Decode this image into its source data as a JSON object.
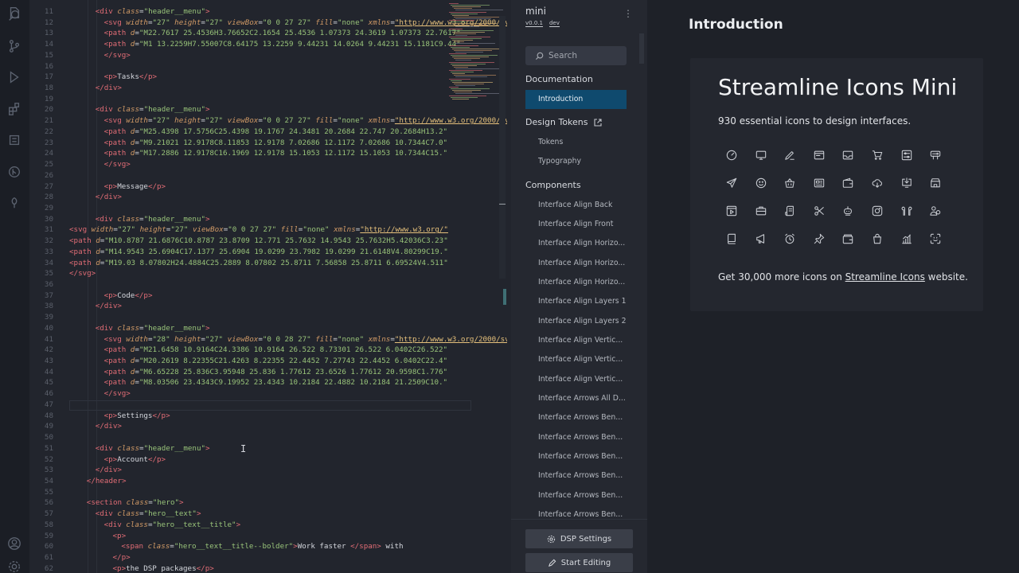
{
  "activity_bar": {
    "icons": [
      "files-icon",
      "search-icon",
      "source-control-icon",
      "run-debug-icon",
      "extensions-icon",
      "list-icon",
      "git-graph-icon",
      "plugin-icon"
    ],
    "bottom_icons": [
      "account-icon",
      "gear-icon"
    ]
  },
  "editor": {
    "lines": [
      {
        "n": "11",
        "indent": 6,
        "parts": [
          [
            "tag",
            "<div "
          ],
          [
            "attr",
            "class"
          ],
          [
            "txt",
            "="
          ],
          [
            "str",
            "\"header__menu\""
          ],
          [
            "tag",
            ">"
          ]
        ]
      },
      {
        "n": "12",
        "indent": 8,
        "parts": [
          [
            "tag",
            "<svg "
          ],
          [
            "attr",
            "width"
          ],
          [
            "txt",
            "="
          ],
          [
            "str",
            "\"27\" "
          ],
          [
            "attr",
            "height"
          ],
          [
            "txt",
            "="
          ],
          [
            "str",
            "\"27\" "
          ],
          [
            "attr",
            "viewBox"
          ],
          [
            "txt",
            "="
          ],
          [
            "str",
            "\"0 0 27 27\" "
          ],
          [
            "attr",
            "fill"
          ],
          [
            "txt",
            "="
          ],
          [
            "str",
            "\"none\" "
          ],
          [
            "attr",
            "xmlns"
          ],
          [
            "txt",
            "="
          ],
          [
            "url",
            "\"http://www.w3.org/2000/svg\""
          ]
        ]
      },
      {
        "n": "13",
        "indent": 8,
        "parts": [
          [
            "tag",
            "<path "
          ],
          [
            "attr",
            "d"
          ],
          [
            "txt",
            "="
          ],
          [
            "str",
            "\"M22.7617 25.4536H3.76652C2.1654 25.4536 1.07373 24.3619 1.07373 22.7617\""
          ]
        ]
      },
      {
        "n": "14",
        "indent": 8,
        "parts": [
          [
            "tag",
            "<path "
          ],
          [
            "attr",
            "d"
          ],
          [
            "txt",
            "="
          ],
          [
            "str",
            "\"M1 13.2259H7.55007C8.64175 13.2259 9.44231 14.0264 9.44231 15.1181C9.44\""
          ]
        ]
      },
      {
        "n": "15",
        "indent": 8,
        "parts": [
          [
            "tag",
            "</svg>"
          ]
        ]
      },
      {
        "n": "16",
        "indent": 0,
        "parts": []
      },
      {
        "n": "17",
        "indent": 8,
        "parts": [
          [
            "tag",
            "<p>"
          ],
          [
            "txt",
            "Tasks"
          ],
          [
            "tag",
            "</p>"
          ]
        ]
      },
      {
        "n": "18",
        "indent": 6,
        "parts": [
          [
            "tag",
            "</div>"
          ]
        ]
      },
      {
        "n": "19",
        "indent": 0,
        "parts": []
      },
      {
        "n": "20",
        "indent": 6,
        "parts": [
          [
            "tag",
            "<div "
          ],
          [
            "attr",
            "class"
          ],
          [
            "txt",
            "="
          ],
          [
            "str",
            "\"header__menu\""
          ],
          [
            "tag",
            ">"
          ]
        ]
      },
      {
        "n": "21",
        "indent": 8,
        "parts": [
          [
            "tag",
            "<svg "
          ],
          [
            "attr",
            "width"
          ],
          [
            "txt",
            "="
          ],
          [
            "str",
            "\"27\" "
          ],
          [
            "attr",
            "height"
          ],
          [
            "txt",
            "="
          ],
          [
            "str",
            "\"27\" "
          ],
          [
            "attr",
            "viewBox"
          ],
          [
            "txt",
            "="
          ],
          [
            "str",
            "\"0 0 27 27\" "
          ],
          [
            "attr",
            "fill"
          ],
          [
            "txt",
            "="
          ],
          [
            "str",
            "\"none\" "
          ],
          [
            "attr",
            "xmlns"
          ],
          [
            "txt",
            "="
          ],
          [
            "url",
            "\"http://www.w3.org/2000/svg\""
          ]
        ]
      },
      {
        "n": "22",
        "indent": 8,
        "parts": [
          [
            "tag",
            "<path "
          ],
          [
            "attr",
            "d"
          ],
          [
            "txt",
            "="
          ],
          [
            "str",
            "\"M25.4398 17.5756C25.4398 19.1767 24.3481 20.2684 22.747 20.2684H13.2\""
          ]
        ]
      },
      {
        "n": "23",
        "indent": 8,
        "parts": [
          [
            "tag",
            "<path "
          ],
          [
            "attr",
            "d"
          ],
          [
            "txt",
            "="
          ],
          [
            "str",
            "\"M9.21021 12.9178C8.11853 12.9178 7.02686 12.1172 7.02686 10.7344C7.0\""
          ]
        ]
      },
      {
        "n": "24",
        "indent": 8,
        "parts": [
          [
            "tag",
            "<path "
          ],
          [
            "attr",
            "d"
          ],
          [
            "txt",
            "="
          ],
          [
            "str",
            "\"M17.2886 12.9178C16.1969 12.9178 15.1053 12.1172 15.1053 10.7344C15.\""
          ]
        ]
      },
      {
        "n": "25",
        "indent": 8,
        "parts": [
          [
            "tag",
            "</svg>"
          ]
        ]
      },
      {
        "n": "26",
        "indent": 0,
        "parts": []
      },
      {
        "n": "27",
        "indent": 8,
        "parts": [
          [
            "tag",
            "<p>"
          ],
          [
            "txt",
            "Message"
          ],
          [
            "tag",
            "</p>"
          ]
        ]
      },
      {
        "n": "28",
        "indent": 6,
        "parts": [
          [
            "tag",
            "</div>"
          ]
        ]
      },
      {
        "n": "29",
        "indent": 0,
        "parts": []
      },
      {
        "n": "30",
        "indent": 6,
        "parts": [
          [
            "tag",
            "<div "
          ],
          [
            "attr",
            "class"
          ],
          [
            "txt",
            "="
          ],
          [
            "str",
            "\"header__menu\""
          ],
          [
            "tag",
            ">"
          ]
        ]
      },
      {
        "n": "31",
        "indent": 0,
        "parts": [
          [
            "tag",
            "<svg "
          ],
          [
            "attr",
            "width"
          ],
          [
            "txt",
            "="
          ],
          [
            "str",
            "\"27\" "
          ],
          [
            "attr",
            "height"
          ],
          [
            "txt",
            "="
          ],
          [
            "str",
            "\"27\" "
          ],
          [
            "attr",
            "viewBox"
          ],
          [
            "txt",
            "="
          ],
          [
            "str",
            "\"0 0 27 27\" "
          ],
          [
            "attr",
            "fill"
          ],
          [
            "txt",
            "="
          ],
          [
            "str",
            "\"none\" "
          ],
          [
            "attr",
            "xmlns"
          ],
          [
            "txt",
            "="
          ],
          [
            "url",
            "\"http://www.w3.org/\""
          ]
        ]
      },
      {
        "n": "32",
        "indent": 0,
        "parts": [
          [
            "tag",
            "<path "
          ],
          [
            "attr",
            "d"
          ],
          [
            "txt",
            "="
          ],
          [
            "str",
            "\"M10.8787 21.6876C10.8787 23.8709 12.771 25.7632 14.9543 25.7632H5.42036C3.23\""
          ]
        ]
      },
      {
        "n": "33",
        "indent": 0,
        "parts": [
          [
            "tag",
            "<path "
          ],
          [
            "attr",
            "d"
          ],
          [
            "txt",
            "="
          ],
          [
            "str",
            "\"M14.9543 25.6904C17.1377 25.6904 19.0299 23.7982 19.0299 21.6148V4.80299C19.\""
          ]
        ]
      },
      {
        "n": "34",
        "indent": 0,
        "parts": [
          [
            "tag",
            "<path "
          ],
          [
            "attr",
            "d"
          ],
          [
            "txt",
            "="
          ],
          [
            "str",
            "\"M19.03 8.07802H24.4884C25.2889 8.07802 25.8711 7.56858 25.8711 6.69524V4.511\""
          ]
        ]
      },
      {
        "n": "35",
        "indent": 0,
        "parts": [
          [
            "tag",
            "</svg>"
          ]
        ]
      },
      {
        "n": "36",
        "indent": 0,
        "parts": []
      },
      {
        "n": "37",
        "indent": 8,
        "parts": [
          [
            "tag",
            "<p>"
          ],
          [
            "txt",
            "Code"
          ],
          [
            "tag",
            "</p>"
          ]
        ]
      },
      {
        "n": "38",
        "indent": 6,
        "parts": [
          [
            "tag",
            "</div>"
          ]
        ]
      },
      {
        "n": "39",
        "indent": 0,
        "parts": []
      },
      {
        "n": "40",
        "indent": 6,
        "parts": [
          [
            "tag",
            "<div "
          ],
          [
            "attr",
            "class"
          ],
          [
            "txt",
            "="
          ],
          [
            "str",
            "\"header__menu\""
          ],
          [
            "tag",
            ">"
          ]
        ]
      },
      {
        "n": "41",
        "indent": 8,
        "parts": [
          [
            "tag",
            "<svg "
          ],
          [
            "attr",
            "width"
          ],
          [
            "txt",
            "="
          ],
          [
            "str",
            "\"28\" "
          ],
          [
            "attr",
            "height"
          ],
          [
            "txt",
            "="
          ],
          [
            "str",
            "\"27\" "
          ],
          [
            "attr",
            "viewBox"
          ],
          [
            "txt",
            "="
          ],
          [
            "str",
            "\"0 0 28 27\" "
          ],
          [
            "attr",
            "fill"
          ],
          [
            "txt",
            "="
          ],
          [
            "str",
            "\"none\" "
          ],
          [
            "attr",
            "xmlns"
          ],
          [
            "txt",
            "="
          ],
          [
            "url",
            "\"http://www.w3.org/2000/svg\""
          ]
        ]
      },
      {
        "n": "42",
        "indent": 8,
        "parts": [
          [
            "tag",
            "<path "
          ],
          [
            "attr",
            "d"
          ],
          [
            "txt",
            "="
          ],
          [
            "str",
            "\"M21.6458 10.9164C24.3386 10.9164 26.522 8.73301 26.522 6.0402C26.522\""
          ]
        ]
      },
      {
        "n": "43",
        "indent": 8,
        "parts": [
          [
            "tag",
            "<path "
          ],
          [
            "attr",
            "d"
          ],
          [
            "txt",
            "="
          ],
          [
            "str",
            "\"M20.2619 8.22355C21.4263 8.22355 22.4452 7.27743 22.4452 6.0402C22.4\""
          ]
        ]
      },
      {
        "n": "44",
        "indent": 8,
        "parts": [
          [
            "tag",
            "<path "
          ],
          [
            "attr",
            "d"
          ],
          [
            "txt",
            "="
          ],
          [
            "str",
            "\"M6.65228 25.836C3.95948 25.836 1.77612 23.6526 1.77612 20.9598C1.776\""
          ]
        ]
      },
      {
        "n": "45",
        "indent": 8,
        "parts": [
          [
            "tag",
            "<path "
          ],
          [
            "attr",
            "d"
          ],
          [
            "txt",
            "="
          ],
          [
            "str",
            "\"M8.03506 23.4343C9.19952 23.4343 10.2184 22.4882 10.2184 21.2509C10.\""
          ]
        ]
      },
      {
        "n": "46",
        "indent": 8,
        "parts": [
          [
            "tag",
            "</svg>"
          ]
        ]
      },
      {
        "n": "47",
        "indent": 0,
        "parts": []
      },
      {
        "n": "48",
        "indent": 8,
        "parts": [
          [
            "tag",
            "<p>"
          ],
          [
            "txt",
            "Settings"
          ],
          [
            "tag",
            "</p>"
          ]
        ]
      },
      {
        "n": "49",
        "indent": 6,
        "parts": [
          [
            "tag",
            "</div>"
          ]
        ]
      },
      {
        "n": "50",
        "indent": 0,
        "parts": []
      },
      {
        "n": "51",
        "indent": 6,
        "parts": [
          [
            "tag",
            "<div "
          ],
          [
            "attr",
            "class"
          ],
          [
            "txt",
            "="
          ],
          [
            "str",
            "\"header__menu\""
          ],
          [
            "tag",
            ">"
          ]
        ]
      },
      {
        "n": "52",
        "indent": 8,
        "parts": [
          [
            "tag",
            "<p>"
          ],
          [
            "txt",
            "Account"
          ],
          [
            "tag",
            "</p>"
          ]
        ]
      },
      {
        "n": "53",
        "indent": 6,
        "parts": [
          [
            "tag",
            "</div>"
          ]
        ]
      },
      {
        "n": "54",
        "indent": 4,
        "parts": [
          [
            "tag",
            "</header>"
          ]
        ]
      },
      {
        "n": "55",
        "indent": 0,
        "parts": []
      },
      {
        "n": "56",
        "indent": 4,
        "parts": [
          [
            "tag",
            "<section "
          ],
          [
            "attr",
            "class"
          ],
          [
            "txt",
            "="
          ],
          [
            "str",
            "\"hero\""
          ],
          [
            "tag",
            ">"
          ]
        ]
      },
      {
        "n": "57",
        "indent": 6,
        "parts": [
          [
            "tag",
            "<div "
          ],
          [
            "attr",
            "class"
          ],
          [
            "txt",
            "="
          ],
          [
            "str",
            "\"hero__text\""
          ],
          [
            "tag",
            ">"
          ]
        ]
      },
      {
        "n": "58",
        "indent": 8,
        "parts": [
          [
            "tag",
            "<div "
          ],
          [
            "attr",
            "class"
          ],
          [
            "txt",
            "="
          ],
          [
            "str",
            "\"hero__text__title\""
          ],
          [
            "tag",
            ">"
          ]
        ]
      },
      {
        "n": "59",
        "indent": 10,
        "parts": [
          [
            "tag",
            "<p>"
          ]
        ]
      },
      {
        "n": "60",
        "indent": 12,
        "parts": [
          [
            "tag",
            "<span "
          ],
          [
            "attr",
            "class"
          ],
          [
            "txt",
            "="
          ],
          [
            "str",
            "\"hero__text__title--bolder\""
          ],
          [
            "tag",
            ">"
          ],
          [
            "txt",
            "Work faster "
          ],
          [
            "tag",
            "</span>"
          ],
          [
            "txt",
            " with"
          ]
        ]
      },
      {
        "n": "61",
        "indent": 10,
        "parts": [
          [
            "tag",
            "</p>"
          ]
        ]
      },
      {
        "n": "62",
        "indent": 10,
        "parts": [
          [
            "tag",
            "<p>"
          ],
          [
            "txt",
            "the DSP packages"
          ],
          [
            "tag",
            "</p>"
          ]
        ]
      }
    ]
  },
  "dsp": {
    "brand": "mini",
    "version": "v0.0.1",
    "branch": "dev",
    "search_placeholder": "Search",
    "sections": {
      "documentation": "Documentation",
      "design_tokens": "Design Tokens",
      "components": "Components"
    },
    "doc_items": [
      "Introduction"
    ],
    "token_items": [
      "Tokens",
      "Typography"
    ],
    "component_items": [
      "Interface Align Back",
      "Interface Align Front",
      "Interface Align Horizo...",
      "Interface Align Horizo...",
      "Interface Align Horizo...",
      "Interface Align Layers 1",
      "Interface Align Layers 2",
      "Interface Align Vertic...",
      "Interface Align Vertic...",
      "Interface Align Vertic...",
      "Interface Arrows All D...",
      "Interface Arrows Ben...",
      "Interface Arrows Ben...",
      "Interface Arrows Ben...",
      "Interface Arrows Ben...",
      "Interface Arrows Ben...",
      "Interface Arrows Ben..."
    ],
    "settings_button": "DSP Settings",
    "edit_button": "Start Editing"
  },
  "main": {
    "page_title": "Introduction",
    "card_title": "Streamline Icons Mini",
    "card_subtitle": "930 essential icons to design interfaces.",
    "icons": [
      "dashboard-gauge-icon",
      "monitor-icon",
      "edit-pencil-icon",
      "browser-window-icon",
      "inbox-tray-icon",
      "shopping-cart-icon",
      "sliders-settings-icon",
      "sliders-panel-icon",
      "paper-plane-icon",
      "smiley-icon",
      "shopping-basket-icon",
      "newspaper-icon",
      "wallet-icon",
      "cloud-transfer-icon",
      "download-screen-icon",
      "store-icon",
      "video-player-icon",
      "briefcase-icon",
      "script-icon",
      "scissors-icon",
      "robot-icon",
      "camera-icon",
      "airpods-icon",
      "users-icon",
      "book-icon",
      "megaphone-icon",
      "alarm-clock-icon",
      "pin-icon",
      "card-wallet-icon",
      "shopping-bag-icon",
      "bar-chart-icon",
      "face-scan-icon"
    ],
    "footer_prefix": "Get 30,000 more icons on ",
    "footer_link": "Streamline Icons",
    "footer_suffix": " website."
  }
}
